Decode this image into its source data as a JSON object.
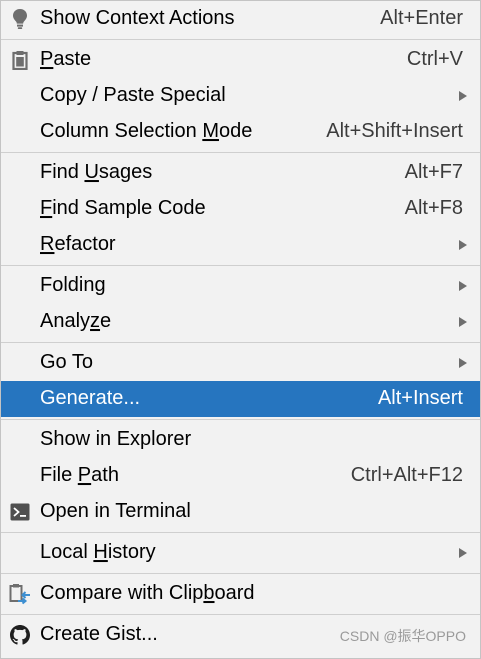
{
  "menu": {
    "groups": [
      [
        {
          "label": "Show Context Actions",
          "shortcut": "Alt+Enter",
          "icon": "lightbulb-icon"
        }
      ],
      [
        {
          "label_pre": "",
          "label_mn": "P",
          "label_post": "aste",
          "shortcut": "Ctrl+V",
          "icon": "clipboard-icon"
        },
        {
          "label": "Copy / Paste Special",
          "submenu": true
        },
        {
          "label_pre": "Column Selection ",
          "label_mn": "M",
          "label_post": "ode",
          "shortcut": "Alt+Shift+Insert"
        }
      ],
      [
        {
          "label_pre": "Find ",
          "label_mn": "U",
          "label_post": "sages",
          "shortcut": "Alt+F7"
        },
        {
          "label_pre": "",
          "label_mn": "F",
          "label_post": "ind Sample Code",
          "shortcut": "Alt+F8"
        },
        {
          "label_pre": "",
          "label_mn": "R",
          "label_post": "efactor",
          "submenu": true
        }
      ],
      [
        {
          "label": "Folding",
          "submenu": true
        },
        {
          "label_pre": "Analy",
          "label_mn": "z",
          "label_post": "e",
          "submenu": true
        }
      ],
      [
        {
          "label": "Go To",
          "submenu": true
        },
        {
          "label": "Generate...",
          "shortcut": "Alt+Insert",
          "selected": true
        }
      ],
      [
        {
          "label": "Show in Explorer"
        },
        {
          "label_pre": "File ",
          "label_mn": "P",
          "label_post": "ath",
          "shortcut": "Ctrl+Alt+F12"
        },
        {
          "label": "Open in Terminal",
          "icon": "terminal-icon"
        }
      ],
      [
        {
          "label_pre": "Local ",
          "label_mn": "H",
          "label_post": "istory",
          "submenu": true
        }
      ],
      [
        {
          "label_pre": "Compare with Clip",
          "label_mn": "b",
          "label_post": "oard",
          "icon": "compare-clipboard-icon"
        }
      ],
      [
        {
          "label": "Create Gist...",
          "icon": "github-icon"
        }
      ]
    ]
  },
  "watermark": "CSDN @振华OPPO",
  "colors": {
    "selected_bg": "#2675bf",
    "menu_bg": "#f2f2f2",
    "separator": "#cfcfcf",
    "icon_blue": "#3d8fd1"
  }
}
